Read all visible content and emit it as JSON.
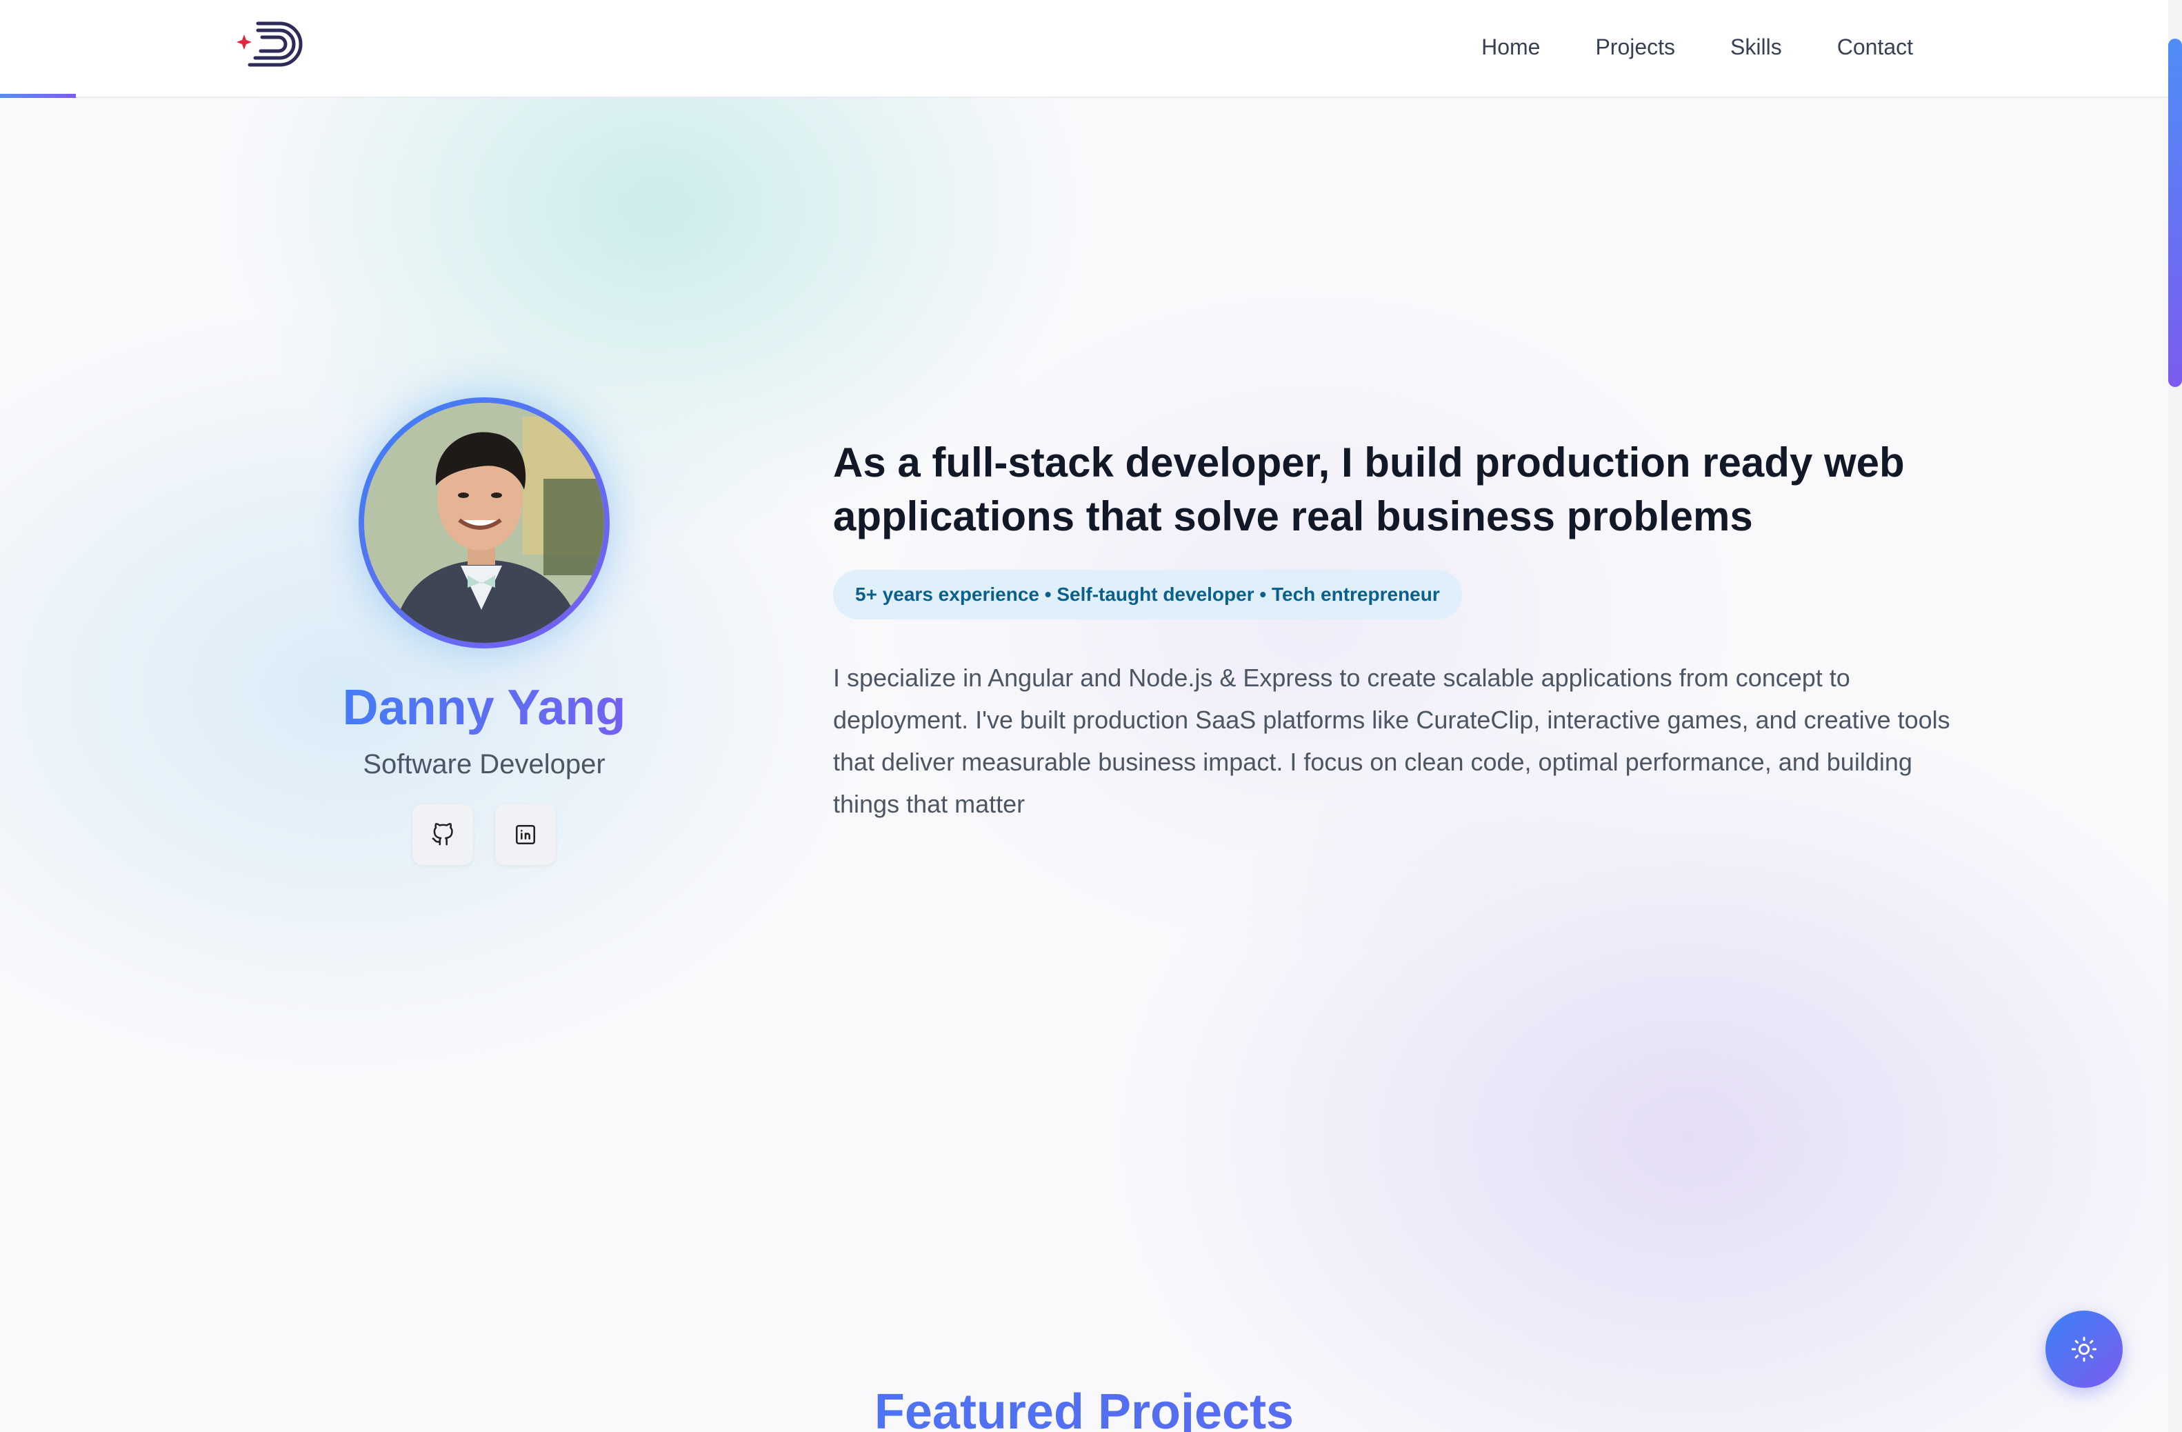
{
  "nav": {
    "items": [
      {
        "label": "Home"
      },
      {
        "label": "Projects"
      },
      {
        "label": "Skills"
      },
      {
        "label": "Contact"
      }
    ]
  },
  "scroll_progress_fraction": 0.035,
  "profile": {
    "name": "Danny Yang",
    "role": "Software Developer",
    "socials": [
      {
        "icon": "github-icon"
      },
      {
        "icon": "linkedin-icon"
      }
    ]
  },
  "intro": {
    "headline": "As a full-stack developer, I build production ready web applications that solve real business problems",
    "badge": "5+ years experience • Self-taught developer • Tech entrepreneur",
    "bio": "I specialize in Angular and Node.js & Express to create scalable applications from concept to deployment. I've built production SaaS platforms like CurateClip, interactive games, and creative tools that deliver measurable business impact. I focus on clean code, optimal performance, and building things that matter"
  },
  "next_section": {
    "title": "Featured Projects"
  },
  "theme_toggle": {
    "icon": "sun-icon"
  },
  "colors": {
    "accent_start": "#3b82f6",
    "accent_end": "#7c5cf0",
    "badge_text": "#0b5f8a",
    "heading": "#111827",
    "body_text": "#4b5563"
  }
}
